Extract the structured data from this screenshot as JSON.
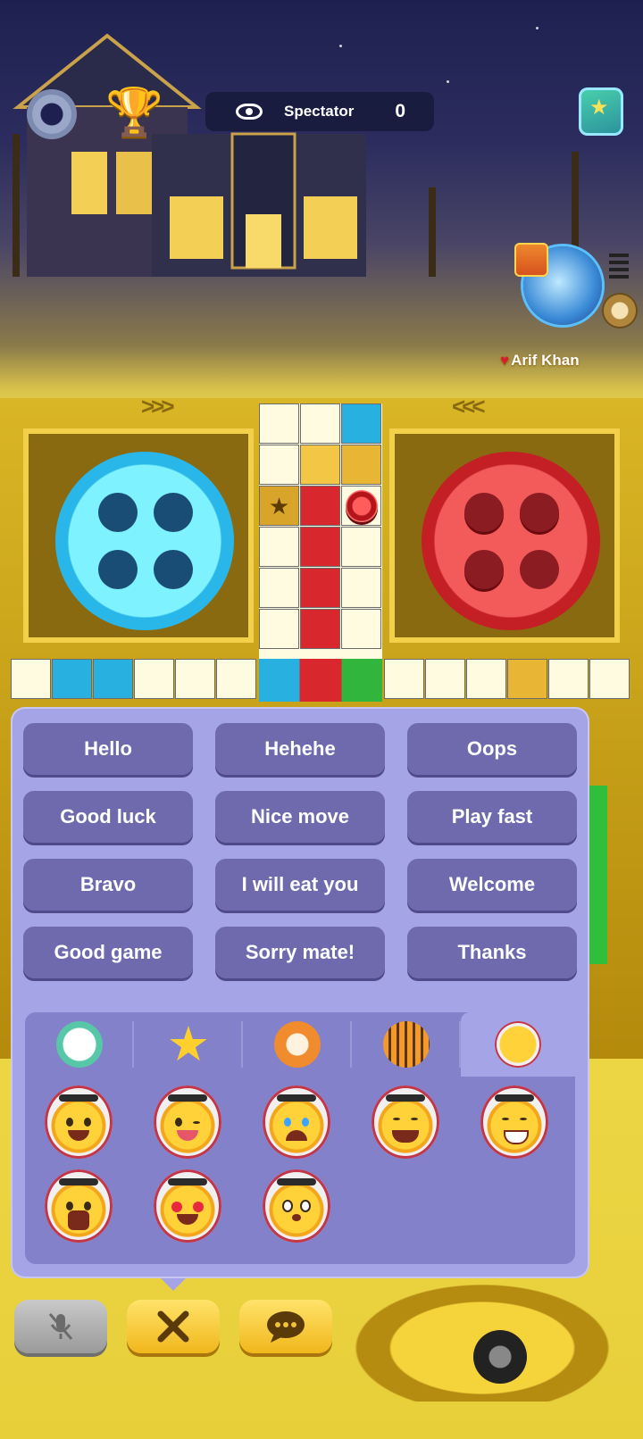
{
  "hud": {
    "spectator_label": "Spectator",
    "spectator_count": "0"
  },
  "player": {
    "name": "Arif Khan"
  },
  "quick_chat": {
    "buttons": [
      "Hello",
      "Hehehe",
      "Oops",
      "Good luck",
      "Nice move",
      "Play fast",
      "Bravo",
      "I will eat you",
      "Welcome",
      "Good game",
      "Sorry mate!",
      "Thanks"
    ]
  },
  "emoji_tabs": [
    {
      "icon": "cool-face-icon"
    },
    {
      "icon": "star-icon"
    },
    {
      "icon": "fox-icon"
    },
    {
      "icon": "tiger-icon"
    },
    {
      "icon": "arab-face-icon",
      "selected": true
    }
  ],
  "emojis": [
    "angry-face-icon",
    "winking-tongue-face-icon",
    "crying-face-icon",
    "laughing-tears-face-icon",
    "grinning-sweat-face-icon",
    "shouting-face-icon",
    "heart-eyes-face-icon",
    "worried-face-icon"
  ],
  "colors": {
    "panel": "#a5a4e6",
    "button": "#6e6aad",
    "blue_home": "#28b0e0",
    "red_home": "#d9272e",
    "gold": "#f1b71c"
  }
}
